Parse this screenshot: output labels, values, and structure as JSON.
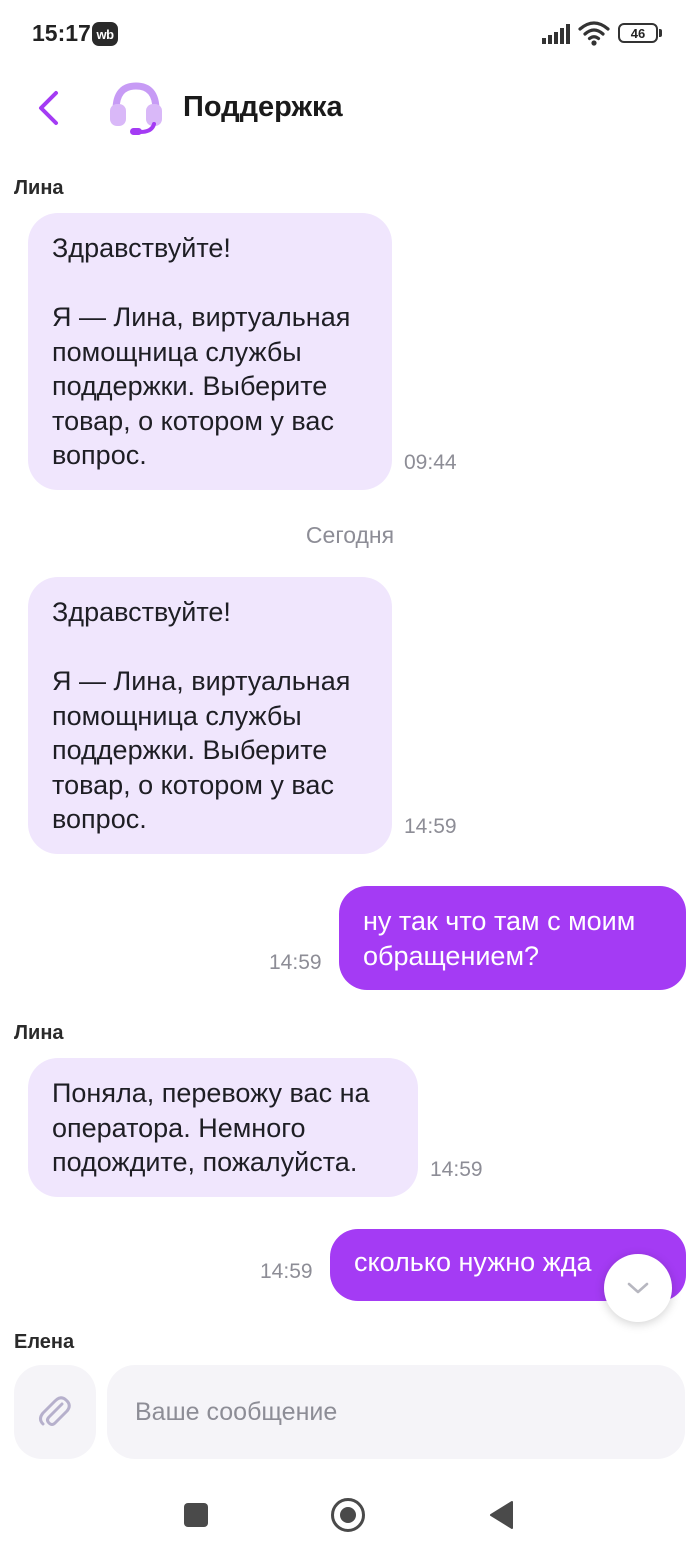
{
  "status_bar": {
    "time": "15:17",
    "app_badge": "wb",
    "battery": "46"
  },
  "header": {
    "title": "Поддержка",
    "back_icon": "chevron-left-icon",
    "avatar_icon": "headset-icon"
  },
  "messages": [
    {
      "sender": "Лина",
      "direction": "incoming",
      "text": "Здравствуйте!\n\nЯ — Лина, виртуальная помощница службы поддержки. Выберите товар, о котором у вас вопрос.",
      "time": "09:44"
    },
    {
      "separator": "Сегодня"
    },
    {
      "direction": "incoming",
      "text": "Здравствуйте!\n\nЯ — Лина, виртуальная помощница службы поддержки. Выберите товар, о котором у вас вопрос.",
      "time": "14:59"
    },
    {
      "direction": "outgoing",
      "text": "ну так что там с моим обращением?",
      "time": "14:59"
    },
    {
      "sender": "Лина",
      "direction": "incoming",
      "text": "Поняла, перевожу вас на оператора. Немного подождите, пожалуйста.",
      "time": "14:59"
    },
    {
      "direction": "outgoing",
      "text": "сколько нужно жда",
      "time": "14:59"
    },
    {
      "sender": "Елена"
    }
  ],
  "composer": {
    "placeholder": "Ваше сообщение",
    "value": "",
    "attach_icon": "paperclip-icon"
  },
  "scroll_button_icon": "chevron-down-icon",
  "colors": {
    "accent": "#a43bf4",
    "incoming_bubble": "#f0e6fd",
    "muted_text": "#8d8d96"
  }
}
